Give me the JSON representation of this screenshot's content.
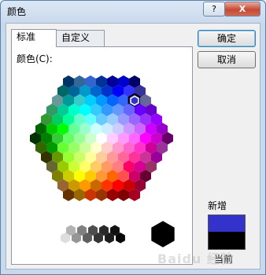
{
  "window": {
    "title": "颜色",
    "help_label": "?",
    "close_label": "X"
  },
  "tabs": [
    {
      "label": "标准",
      "active": true
    },
    {
      "label": "自定义",
      "active": false
    }
  ],
  "panel": {
    "color_label": "颜色(C):"
  },
  "buttons": {
    "ok_label": "确定",
    "cancel_label": "取消"
  },
  "preview": {
    "new_label": "新增",
    "current_label": "当前",
    "new_color": "#3333cc",
    "current_color": "#000000"
  },
  "watermark": "Baidu 经验",
  "colors": {
    "hex_rows": [
      [
        "#003366",
        "#336699",
        "#3366cc",
        "#003399",
        "#000099",
        "#0000cc",
        "#000066"
      ],
      [
        "#006666",
        "#006699",
        "#0099cc",
        "#0066cc",
        "#0033cc",
        "#0000ff",
        "#3333ff",
        "#333399"
      ],
      [
        "#669999",
        "#009999",
        "#33cccc",
        "#00ccff",
        "#0099ff",
        "#0066ff",
        "#3366ff",
        "#3333cc",
        "#666699"
      ],
      [
        "#339966",
        "#00cc99",
        "#00ffcc",
        "#00ffff",
        "#33ccff",
        "#3399ff",
        "#6699ff",
        "#6666ff",
        "#6600ff",
        "#6600cc"
      ],
      [
        "#339933",
        "#00cc66",
        "#00ff99",
        "#66ffcc",
        "#66ffff",
        "#66ccff",
        "#99ccff",
        "#9999ff",
        "#9966ff",
        "#9933ff",
        "#9900ff"
      ],
      [
        "#006600",
        "#00cc00",
        "#00ff00",
        "#66ff99",
        "#99ffcc",
        "#ccffff",
        "#ccecff",
        "#ccccff",
        "#cc99ff",
        "#cc66ff",
        "#cc00ff",
        "#9900cc"
      ],
      [
        "#003300",
        "#008000",
        "#33cc33",
        "#66ff66",
        "#99ff99",
        "#ccffcc",
        "#ffffff",
        "#ffccff",
        "#ff99ff",
        "#ff66ff",
        "#ff00ff",
        "#cc00cc",
        "#660066"
      ],
      [
        "#336600",
        "#009900",
        "#66ff33",
        "#99ff66",
        "#ccff99",
        "#ffffcc",
        "#ffcccc",
        "#ff99cc",
        "#ff66cc",
        "#ff33cc",
        "#cc0099",
        "#993399"
      ],
      [
        "#333300",
        "#669900",
        "#99ff33",
        "#ccff66",
        "#ffff99",
        "#ffcc99",
        "#ff9999",
        "#ff6699",
        "#ff3399",
        "#cc3399",
        "#990099"
      ],
      [
        "#666633",
        "#99cc00",
        "#ccff33",
        "#ffff66",
        "#ffcc66",
        "#ff9966",
        "#ff7c80",
        "#ff0066",
        "#d60093",
        "#993366"
      ],
      [
        "#808000",
        "#cccc00",
        "#ffff00",
        "#ffcc00",
        "#ff9933",
        "#ff6600",
        "#ff5050",
        "#cc0066",
        "#660033"
      ],
      [
        "#996633",
        "#cc9900",
        "#ff9900",
        "#cc6600",
        "#ff3300",
        "#ff0000",
        "#cc0000",
        "#990033"
      ],
      [
        "#663300",
        "#996600",
        "#cc3300",
        "#993300",
        "#990000",
        "#800000",
        "#a50021"
      ]
    ],
    "grays": [
      "#ffffff",
      "#dddddd",
      "#b2b2b2",
      "#969696",
      "#808080",
      "#5f5f5f",
      "#4d4d4d",
      "#333333",
      "#292929",
      "#1c1c1c",
      "#111111",
      "#080808"
    ],
    "black": "#000000",
    "selected_color": "#3333cc"
  }
}
